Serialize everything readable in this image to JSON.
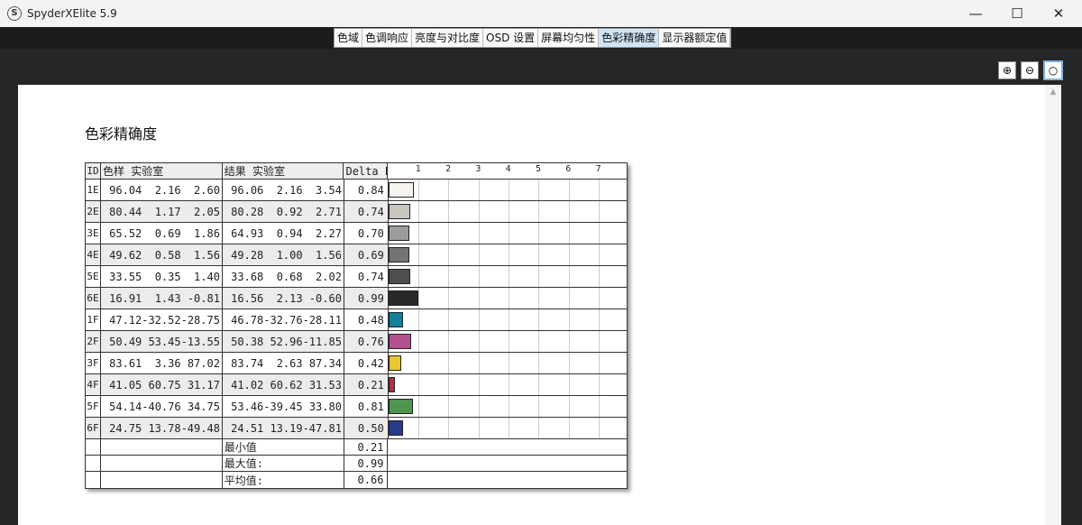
{
  "window": {
    "title": "SpyderXElite 5.9",
    "minimize": "—",
    "maximize": "☐",
    "close": "✕"
  },
  "tabs": [
    {
      "label": "色域"
    },
    {
      "label": "色调响应"
    },
    {
      "label": "亮度与对比度"
    },
    {
      "label": "OSD 设置"
    },
    {
      "label": "屏幕均匀性"
    },
    {
      "label": "色彩精确度",
      "active": true
    },
    {
      "label": "显示器额定值"
    }
  ],
  "toolbar": {
    "zoom_in": "zoom-in-icon",
    "zoom_out": "zoom-out-icon",
    "zoom_fit": "zoom-fit-icon"
  },
  "report": {
    "title": "色彩精确度",
    "headers": {
      "id": "ID",
      "sample": "色样 实验室",
      "result": "结果 实验室",
      "delta": "Delta E"
    },
    "rows": [
      {
        "id": "1E",
        "s": [
          "96.04",
          "2.16",
          "2.60"
        ],
        "r": [
          "96.06",
          "2.16",
          "3.54"
        ],
        "de": "0.84",
        "color": "#f7f3ee"
      },
      {
        "id": "2E",
        "s": [
          "80.44",
          "1.17",
          "2.05"
        ],
        "r": [
          "80.28",
          "0.92",
          "2.71"
        ],
        "de": "0.74",
        "color": "#c9c6c2"
      },
      {
        "id": "3E",
        "s": [
          "65.52",
          "0.69",
          "1.86"
        ],
        "r": [
          "64.93",
          "0.94",
          "2.27"
        ],
        "de": "0.70",
        "color": "#9e9c9a"
      },
      {
        "id": "4E",
        "s": [
          "49.62",
          "0.58",
          "1.56"
        ],
        "r": [
          "49.28",
          "1.00",
          "1.56"
        ],
        "de": "0.69",
        "color": "#767473"
      },
      {
        "id": "5E",
        "s": [
          "33.55",
          "0.35",
          "1.40"
        ],
        "r": [
          "33.68",
          "0.68",
          "2.02"
        ],
        "de": "0.74",
        "color": "#504e4d"
      },
      {
        "id": "6E",
        "s": [
          "16.91",
          "1.43",
          "-0.81"
        ],
        "r": [
          "16.56",
          "2.13",
          "-0.60"
        ],
        "de": "0.99",
        "color": "#2a2828"
      },
      {
        "id": "1F",
        "s": [
          "47.12",
          "-32.52",
          "-28.75"
        ],
        "r": [
          "46.78",
          "-32.76",
          "-28.11"
        ],
        "de": "0.48",
        "color": "#12809a"
      },
      {
        "id": "2F",
        "s": [
          "50.49",
          "53.45",
          "-13.55"
        ],
        "r": [
          "50.38",
          "52.96",
          "-11.85"
        ],
        "de": "0.76",
        "color": "#b5508f"
      },
      {
        "id": "3F",
        "s": [
          "83.61",
          "3.36",
          "87.02"
        ],
        "r": [
          "83.74",
          "2.63",
          "87.34"
        ],
        "de": "0.42",
        "color": "#e8c531"
      },
      {
        "id": "4F",
        "s": [
          "41.05",
          "60.75",
          "31.17"
        ],
        "r": [
          "41.02",
          "60.62",
          "31.53"
        ],
        "de": "0.21",
        "color": "#b0303f"
      },
      {
        "id": "5F",
        "s": [
          "54.14",
          "-40.76",
          "34.75"
        ],
        "r": [
          "53.46",
          "-39.45",
          "33.80"
        ],
        "de": "0.81",
        "color": "#4f9550"
      },
      {
        "id": "6F",
        "s": [
          "24.75",
          "13.78",
          "-49.48"
        ],
        "r": [
          "24.51",
          "13.19",
          "-47.81"
        ],
        "de": "0.50",
        "color": "#283a8c"
      }
    ],
    "summary": [
      {
        "label": "最小值",
        "value": "0.21"
      },
      {
        "label": "最大值:",
        "value": "0.99"
      },
      {
        "label": "平均值:",
        "value": "0.66"
      }
    ],
    "axis_ticks": [
      "1",
      "2",
      "3",
      "4",
      "5",
      "6",
      "7"
    ]
  }
}
